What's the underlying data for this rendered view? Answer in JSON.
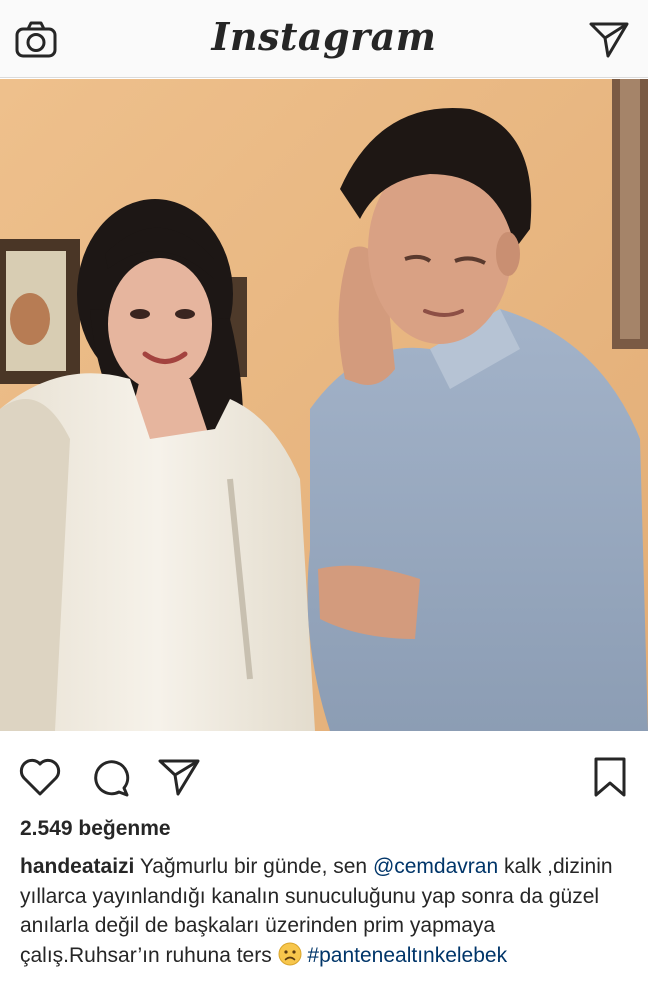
{
  "topbar": {
    "title": "Instagram",
    "left_icon": "camera-icon",
    "right_icon": "direct-send-icon"
  },
  "post": {
    "image_alt": "",
    "actions": {
      "like_icon": "heart-icon",
      "comment_icon": "comment-icon",
      "share_icon": "share-icon",
      "save_icon": "bookmark-icon"
    },
    "likes_text": "2.549 beğenme",
    "caption": {
      "username": "handeataizi",
      "text_1": "Yağmurlu bir günde, sen",
      "mention": "@cemdavran",
      "text_2": "kalk ,dizinin yıllarca yayınlandığı kanalın sunuculuğunu yap sonra da güzel anılarla değil de başkaları üzerinden prim yapmaya çalış.Ruhsar’ın ruhuna ters",
      "emoji": "frowning-face-emoji",
      "hashtag": "#pantenealtınkelebek"
    }
  },
  "colors": {
    "text": "#262626",
    "link": "#003569",
    "bar_bg": "#fafafa",
    "border": "#dbdbdb"
  }
}
